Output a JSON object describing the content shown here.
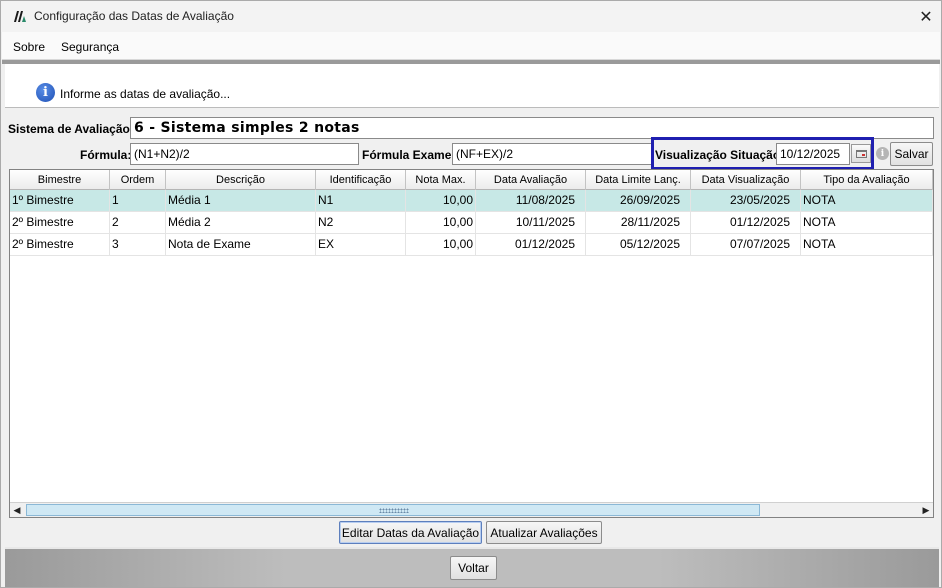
{
  "window": {
    "title": "Configuração das Datas de Avaliação",
    "close_symbol": "✕",
    "app_icon": "app-logo-icon"
  },
  "menu": {
    "items": [
      {
        "label": "Sobre"
      },
      {
        "label": "Segurança"
      }
    ]
  },
  "info": {
    "icon": "info-icon",
    "text": "Informe as datas de avaliação..."
  },
  "form": {
    "sistema_label": "Sistema de Avaliação:",
    "sistema_value": "6 - Sistema simples 2 notas",
    "formula_label": "Fórmula:",
    "formula_value": "(N1+N2)/2",
    "formula_exame_label": "Fórmula Exame:",
    "formula_exame_value": "(NF+EX)/2",
    "visualizacao_label": "Visualização Situação:",
    "visualizacao_value": "10/12/2025",
    "salvar_label": "Salvar"
  },
  "table": {
    "columns": [
      "Bimestre",
      "Ordem",
      "Descrição",
      "Identificação",
      "Nota Max.",
      "Data Avaliação",
      "Data Limite Lanç.",
      "Data Visualização",
      "Tipo da Avaliação"
    ],
    "rows": [
      {
        "bimestre": "1º Bimestre",
        "ordem": "1",
        "descricao": "Média 1",
        "identificacao": "N1",
        "nota_max": "10,00",
        "data_avaliacao": "11/08/2025",
        "data_limite": "26/09/2025",
        "data_visualizacao": "23/05/2025",
        "tipo": "NOTA",
        "selected": true
      },
      {
        "bimestre": "2º Bimestre",
        "ordem": "2",
        "descricao": "Média 2",
        "identificacao": "N2",
        "nota_max": "10,00",
        "data_avaliacao": "10/11/2025",
        "data_limite": "28/11/2025",
        "data_visualizacao": "01/12/2025",
        "tipo": "NOTA",
        "selected": false
      },
      {
        "bimestre": "2º Bimestre",
        "ordem": "3",
        "descricao": "Nota de Exame",
        "identificacao": "EX",
        "nota_max": "10,00",
        "data_avaliacao": "01/12/2025",
        "data_limite": "05/12/2025",
        "data_visualizacao": "07/07/2025",
        "tipo": "NOTA",
        "selected": false
      }
    ]
  },
  "actions": {
    "editar_label": "Editar Datas da Avaliação",
    "atualizar_label": "Atualizar Avaliações",
    "voltar_label": "Voltar"
  },
  "colors": {
    "selected_row": "#c7e8e6",
    "highlight_border": "#1f1fb0"
  }
}
